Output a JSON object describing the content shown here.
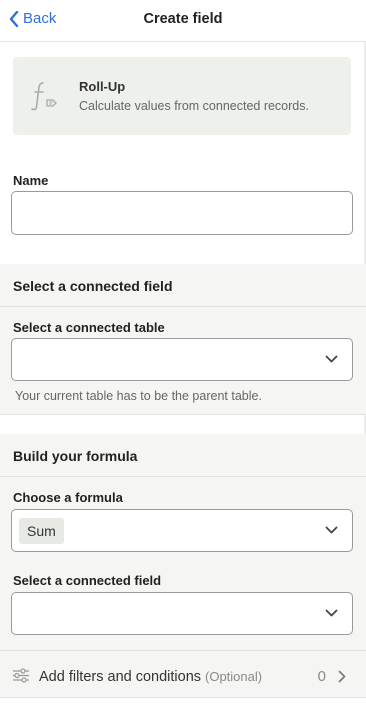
{
  "header": {
    "back_label": "Back",
    "title": "Create field"
  },
  "field_type": {
    "name": "Roll-Up",
    "description": "Calculate values from connected records."
  },
  "name_field": {
    "label": "Name",
    "value": ""
  },
  "connected_section": {
    "title": "Select a connected field",
    "table_label": "Select a connected table",
    "table_value": "",
    "hint": "Your current table has to be the parent table."
  },
  "formula_section": {
    "title": "Build your formula",
    "formula_label": "Choose a formula",
    "formula_value": "Sum",
    "field_label": "Select a connected field",
    "field_value": ""
  },
  "filters": {
    "label": "Add filters and conditions",
    "optional": "(Optional)",
    "count": "0"
  },
  "colors": {
    "accent": "#2f6fdc",
    "section_bg": "#f5f5f3",
    "card_bg": "#eef0ec"
  },
  "icons": [
    "chevron-left-icon",
    "function-icon",
    "chevron-down-icon",
    "sliders-icon",
    "chevron-right-icon"
  ]
}
